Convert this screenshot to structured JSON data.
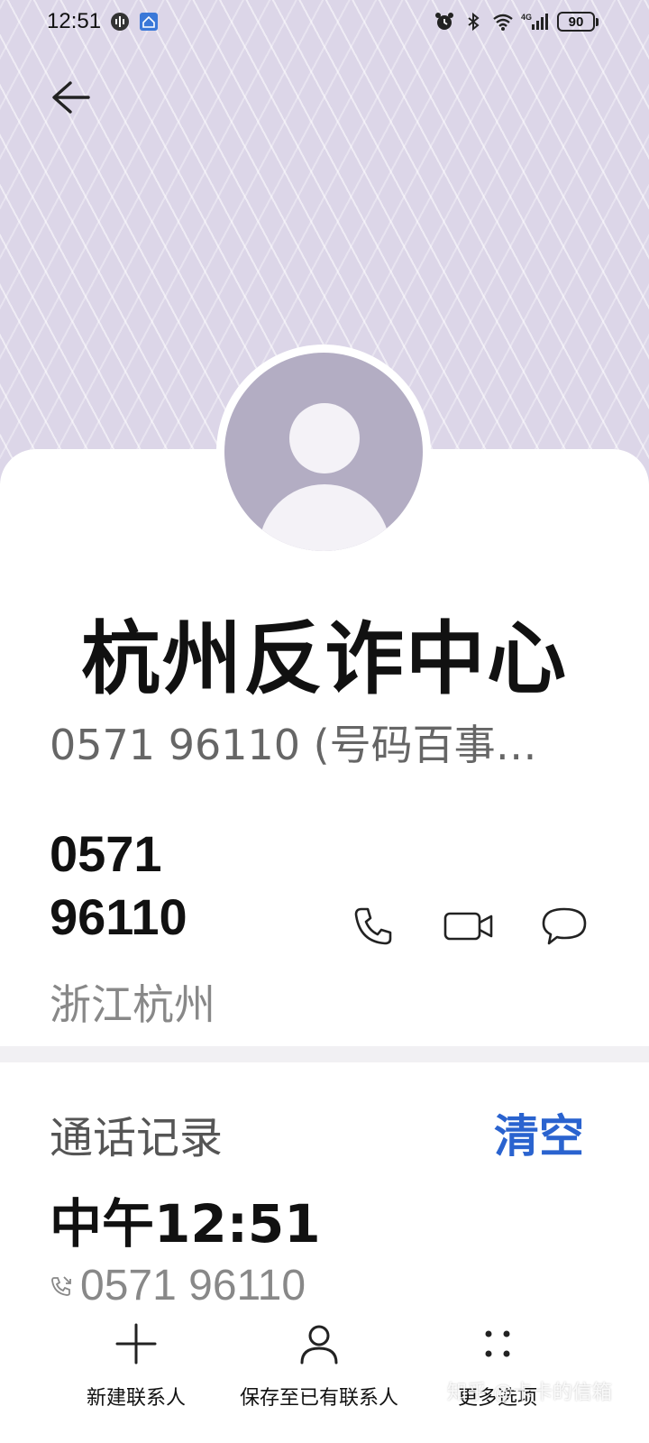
{
  "status_bar": {
    "time": "12:51",
    "battery_level": "90",
    "network_type": "4G",
    "icons": [
      "voice-assistant-icon",
      "app-notification-icon",
      "alarm-icon",
      "bluetooth-icon",
      "wifi-icon",
      "signal-icon",
      "battery-icon"
    ]
  },
  "header": {
    "back_icon": "arrow-left-icon"
  },
  "contact": {
    "name": "杭州反诈中心",
    "subtitle": "0571 96110 (号码百事…",
    "avatar_icon": "person-placeholder-icon"
  },
  "phone": {
    "number_line1": "0571",
    "number_line2": "96110",
    "region": "浙江杭州",
    "actions": [
      {
        "name": "call",
        "icon": "phone-icon"
      },
      {
        "name": "video-call",
        "icon": "video-camera-icon"
      },
      {
        "name": "message",
        "icon": "message-bubble-icon"
      }
    ]
  },
  "call_log": {
    "title": "通话记录",
    "clear_label": "清空",
    "entries": [
      {
        "time": "中午12:51",
        "number": "0571 96110",
        "direction_icon": "missed-call-icon"
      }
    ]
  },
  "bottom_bar": {
    "new_contact_label": "新建联系人",
    "save_existing_label": "保存至已有联系人",
    "more_options_label": "更多选项"
  },
  "watermark": {
    "text": "知乎 @卡卡的信箱"
  },
  "colors": {
    "header_bg": "#dcd6e8",
    "accent_blue": "#2a63cf",
    "avatar_bg": "#b3adc3"
  }
}
